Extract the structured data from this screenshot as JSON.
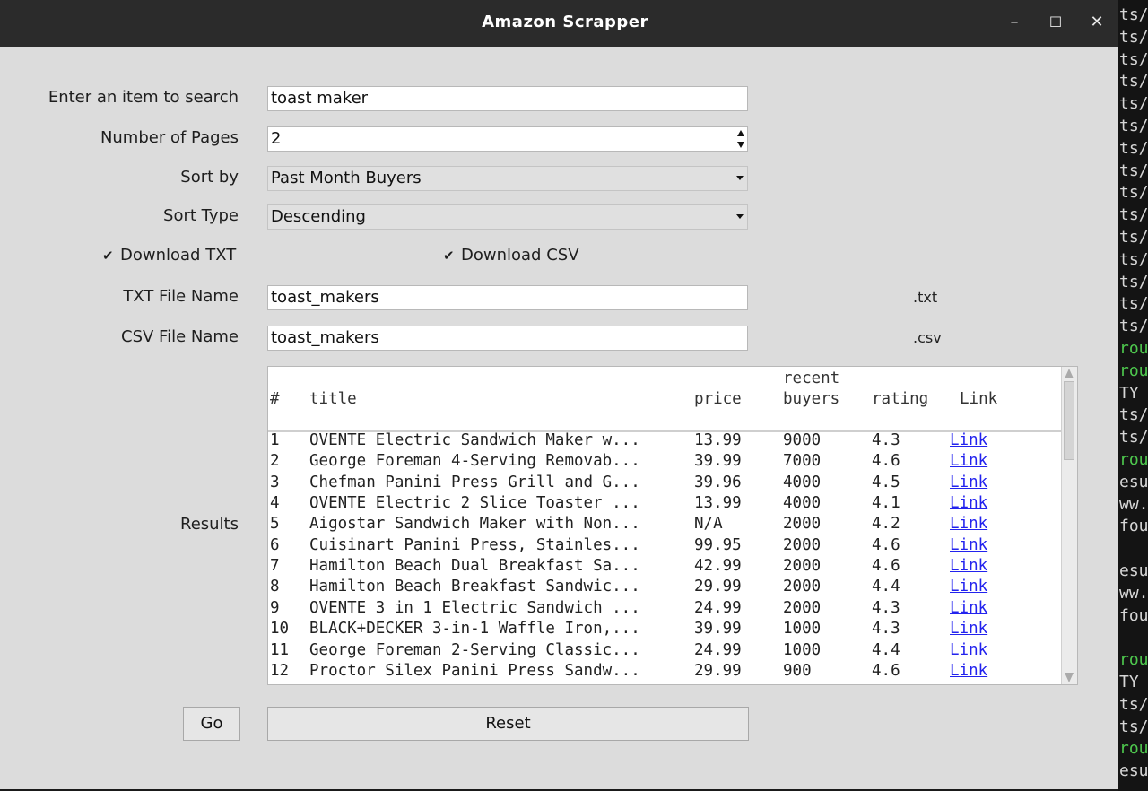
{
  "window": {
    "title": "Amazon Scrapper",
    "minimize": "–",
    "maximize": "☐",
    "close": "✕"
  },
  "form": {
    "search_label": "Enter an item to search",
    "search_value": "toast maker",
    "pages_label": "Number of Pages",
    "pages_value": "2",
    "sortby_label": "Sort by",
    "sortby_value": "Past Month Buyers",
    "sorttype_label": "Sort Type",
    "sorttype_value": "Descending",
    "download_txt_label": "Download TXT",
    "download_txt_checked": true,
    "download_csv_label": "Download CSV",
    "download_csv_checked": true,
    "txt_name_label": "TXT File Name",
    "txt_name_value": "toast_makers",
    "txt_ext": ".txt",
    "csv_name_label": "CSV File Name",
    "csv_name_value": "toast_makers",
    "csv_ext": ".csv",
    "results_label": "Results"
  },
  "table": {
    "headers": {
      "num": "#",
      "title": "title",
      "price": "price",
      "buyers_1": "recent",
      "buyers_2": "buyers",
      "rating": "rating",
      "link": "Link"
    },
    "rows": [
      {
        "num": "1",
        "title": "OVENTE Electric Sandwich Maker w...",
        "price": "13.99",
        "buyers": "9000",
        "rating": "4.3",
        "link": "Link"
      },
      {
        "num": "2",
        "title": "George Foreman 4-Serving Removab...",
        "price": "39.99",
        "buyers": "7000",
        "rating": "4.6",
        "link": "Link"
      },
      {
        "num": "3",
        "title": "Chefman Panini Press Grill and G...",
        "price": "39.96",
        "buyers": "4000",
        "rating": "4.5",
        "link": "Link"
      },
      {
        "num": "4",
        "title": "OVENTE Electric 2 Slice Toaster ...",
        "price": "13.99",
        "buyers": "4000",
        "rating": "4.1",
        "link": "Link"
      },
      {
        "num": "5",
        "title": "Aigostar Sandwich Maker with Non...",
        "price": "N/A",
        "buyers": "2000",
        "rating": "4.2",
        "link": "Link"
      },
      {
        "num": "6",
        "title": "Cuisinart Panini Press, Stainles...",
        "price": "99.95",
        "buyers": "2000",
        "rating": "4.6",
        "link": "Link"
      },
      {
        "num": "7",
        "title": "Hamilton Beach Dual Breakfast Sa...",
        "price": "42.99",
        "buyers": "2000",
        "rating": "4.6",
        "link": "Link"
      },
      {
        "num": "8",
        "title": "Hamilton Beach Breakfast Sandwic...",
        "price": "29.99",
        "buyers": "2000",
        "rating": "4.4",
        "link": "Link"
      },
      {
        "num": "9",
        "title": "OVENTE 3 in 1 Electric Sandwich ...",
        "price": "24.99",
        "buyers": "2000",
        "rating": "4.3",
        "link": "Link"
      },
      {
        "num": "10",
        "title": "BLACK+DECKER 3-in-1 Waffle Iron,...",
        "price": "39.99",
        "buyers": "1000",
        "rating": "4.3",
        "link": "Link"
      },
      {
        "num": "11",
        "title": "George Foreman 2-Serving Classic...",
        "price": "24.99",
        "buyers": "1000",
        "rating": "4.4",
        "link": "Link"
      },
      {
        "num": "12",
        "title": "Proctor Silex Panini Press Sandw...",
        "price": "29.99",
        "buyers": "900",
        "rating": "4.6",
        "link": "Link"
      }
    ]
  },
  "buttons": {
    "go": "Go",
    "reset": "Reset"
  },
  "terminal": {
    "lines": [
      "ts/",
      "ts/",
      "ts/",
      "ts/",
      "ts/",
      "ts/",
      "ts/",
      "ts/",
      "ts/",
      "ts/",
      "ts/",
      "ts/",
      "ts/",
      "ts/",
      "ts/",
      "rou",
      "rou",
      "TY",
      "ts/",
      "ts/",
      "rou",
      "esu",
      "ww.",
      "fou",
      "",
      "esu",
      "ww.",
      "fou",
      "",
      "rou",
      "TY",
      "ts/",
      "ts/",
      "rou",
      "esu"
    ],
    "green_indices": [
      15,
      16,
      20,
      29,
      33
    ]
  }
}
